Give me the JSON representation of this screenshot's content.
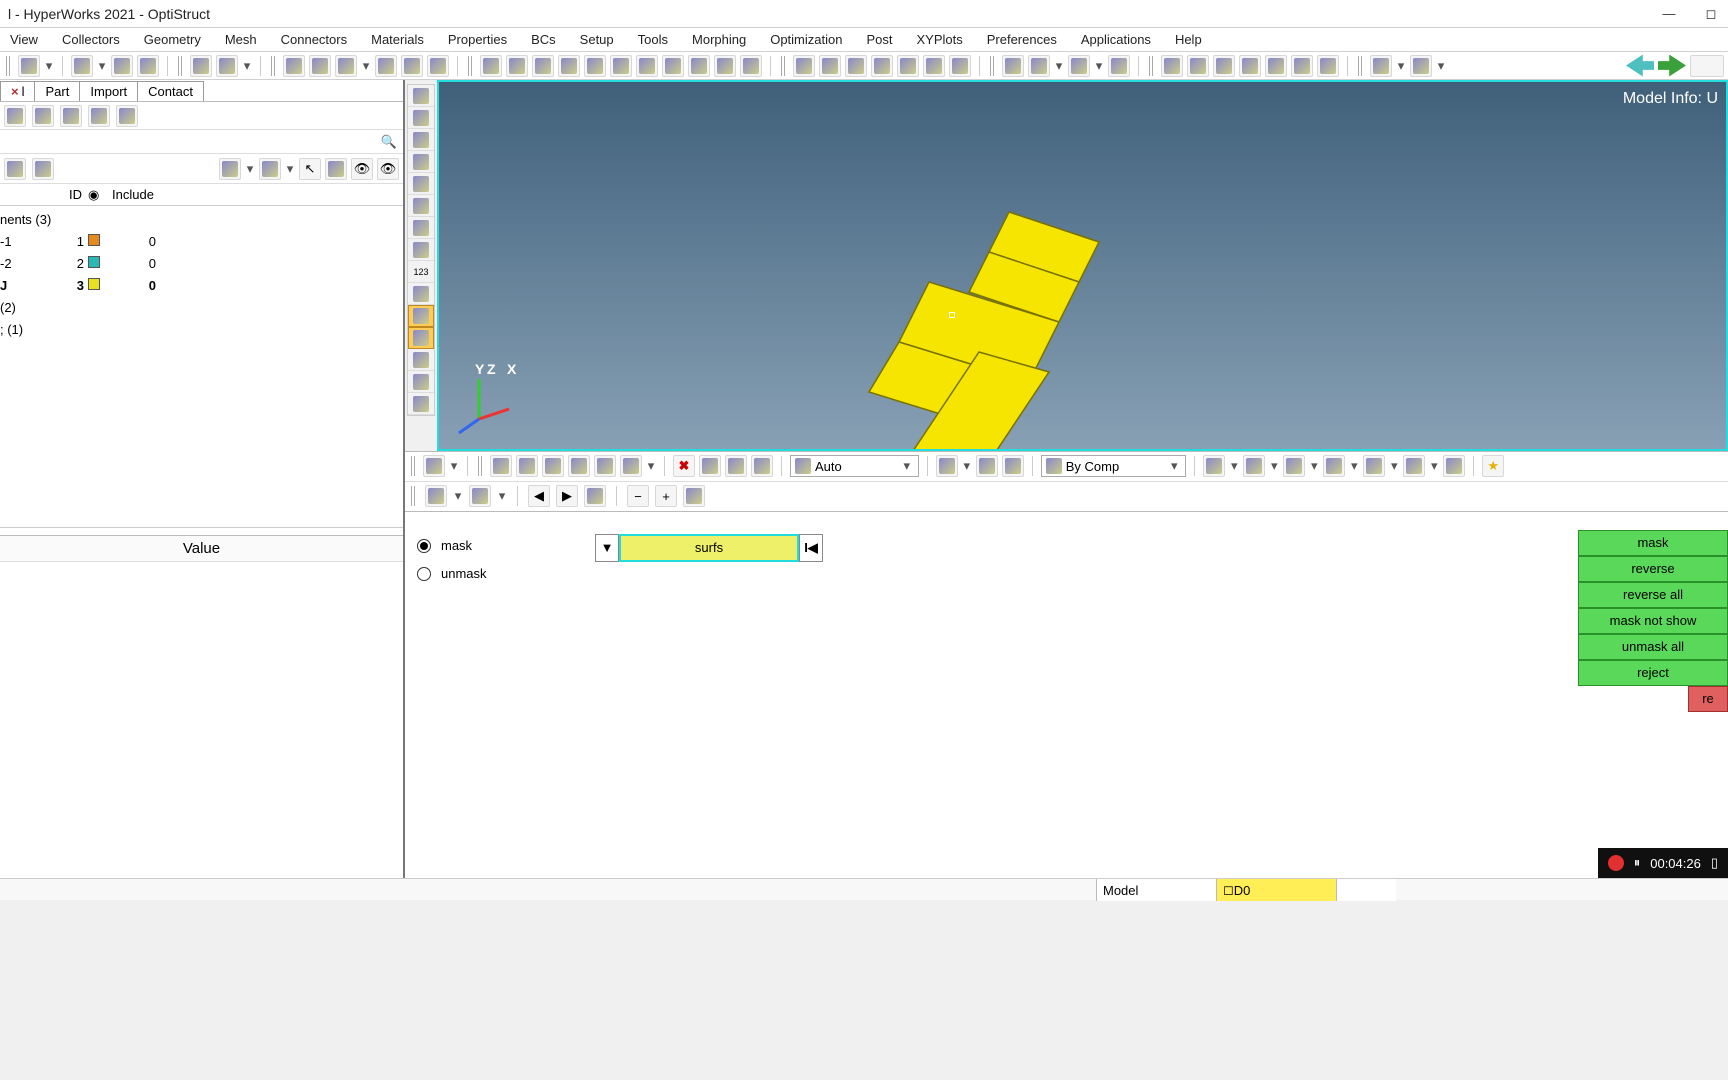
{
  "window": {
    "title": "l - HyperWorks 2021 - OptiStruct"
  },
  "menus": [
    "View",
    "Collectors",
    "Geometry",
    "Mesh",
    "Connectors",
    "Materials",
    "Properties",
    "BCs",
    "Setup",
    "Tools",
    "Morphing",
    "Optimization",
    "Post",
    "XYPlots",
    "Preferences",
    "Applications",
    "Help"
  ],
  "left": {
    "tabs": [
      "l",
      "Part",
      "Import",
      "Contact"
    ],
    "headers": {
      "id": "ID",
      "include": "Include"
    },
    "tree": {
      "rootA": "nents (3)",
      "rows": [
        {
          "name": "-1",
          "id": "1",
          "swatch": "#e68a1f",
          "include": "0",
          "bold": false
        },
        {
          "name": "-2",
          "id": "2",
          "swatch": "#2bb8b4",
          "include": "0",
          "bold": false
        },
        {
          "name": "J",
          "id": "3",
          "swatch": "#e8e020",
          "include": "0",
          "bold": true
        }
      ],
      "extraA": "(2)",
      "extraB": "; (1)"
    },
    "value_header": "Value"
  },
  "viewport": {
    "model_info": "Model Info: U",
    "triad": {
      "x": "X",
      "y": "Y",
      "z": "Z"
    }
  },
  "midbar": {
    "auto_label": "Auto",
    "bycomp_label": "By Comp"
  },
  "panel": {
    "radio": {
      "mask": "mask",
      "unmask": "unmask"
    },
    "selector": {
      "value": "surfs"
    },
    "actions": [
      "mask",
      "reverse",
      "reverse all",
      "mask not show",
      "unmask all",
      "reject"
    ],
    "reject2": "re"
  },
  "recording": {
    "time": "00:04:26",
    "pause_glyph": "⏸"
  },
  "status": {
    "model": "Model",
    "right": "D0"
  }
}
